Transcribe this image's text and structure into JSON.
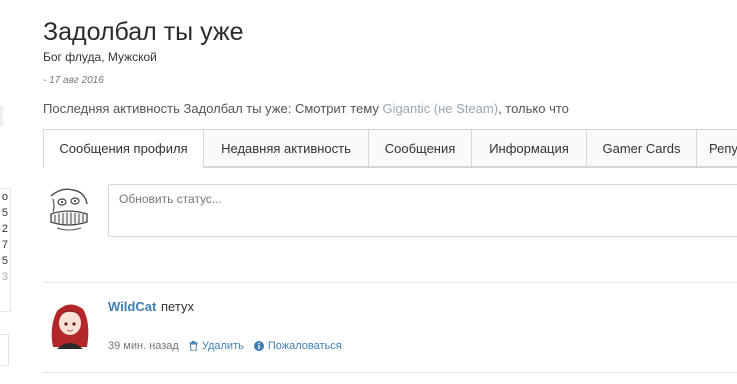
{
  "profile": {
    "title": "Задолбал ты уже",
    "subtitle": "Бог флуда, Мужской",
    "date_prefix": "-",
    "date": "17 авг 2016",
    "activity_prefix": "Последняя активность Задолбал ты уже: Смотрит тему ",
    "activity_link": "Gigantic (не Steam)",
    "activity_suffix": ", только что"
  },
  "tabs": [
    {
      "label": "Сообщения профиля",
      "active": true
    },
    {
      "label": "Недавняя активность"
    },
    {
      "label": "Сообщения"
    },
    {
      "label": "Информация"
    },
    {
      "label": "Gamer Cards"
    },
    {
      "label": "Репу"
    }
  ],
  "status": {
    "placeholder": "Обновить статус..."
  },
  "post": {
    "author": "WildCat",
    "text": "петух",
    "time": "39 мин. назад",
    "delete_label": "Удалить",
    "report_label": "Пожаловаться"
  },
  "left_strip": [
    "о",
    "5",
    "2",
    "7",
    "5",
    "3"
  ],
  "colors": {
    "link": "#3f7fb3",
    "muted_link": "#9aa7b1",
    "border": "#d8d8d8"
  }
}
